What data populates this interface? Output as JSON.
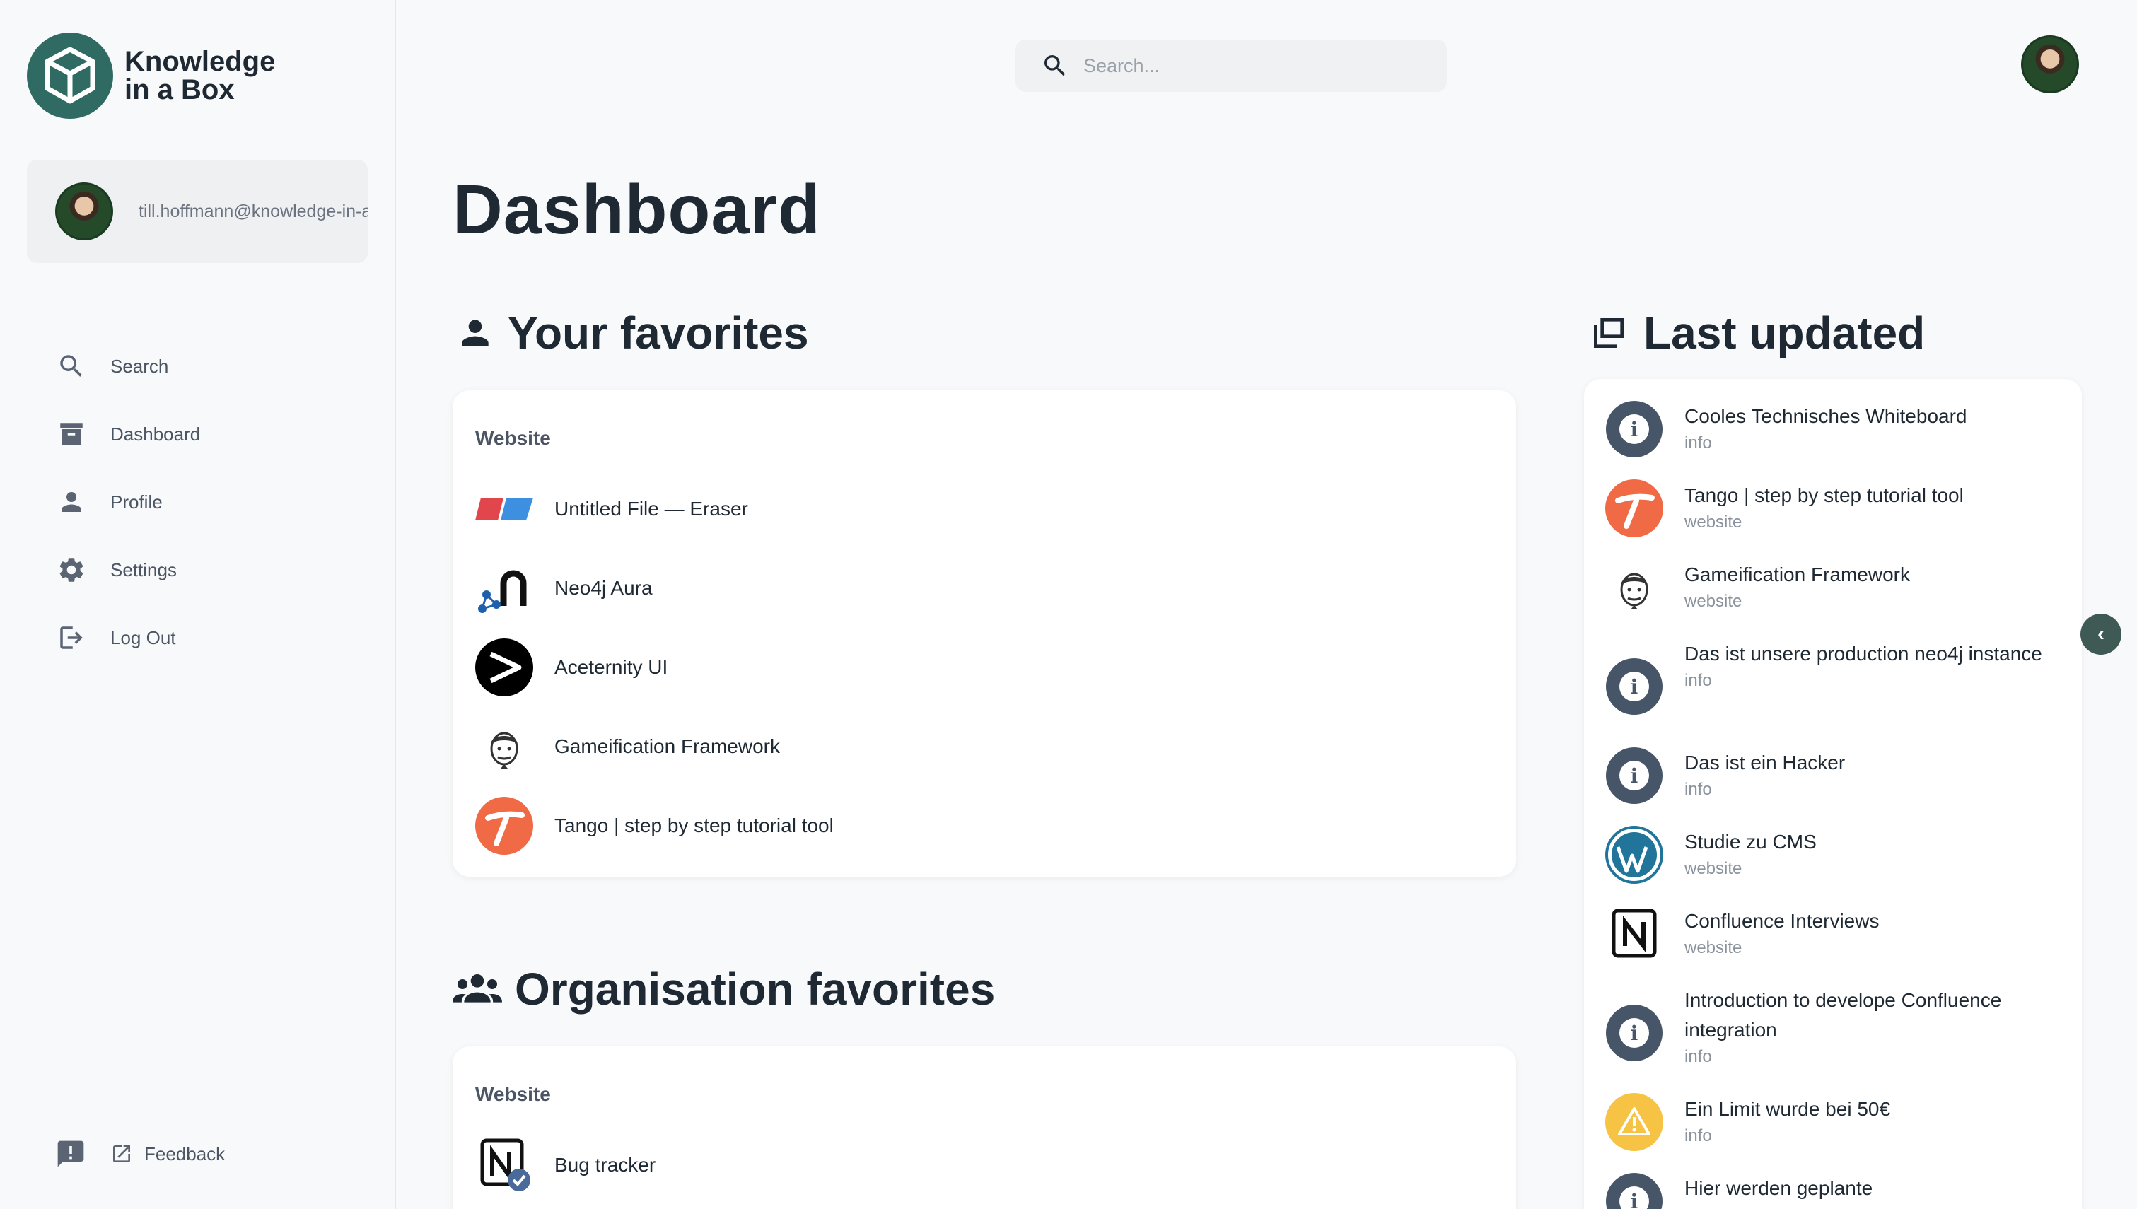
{
  "app": {
    "logo_line1": "Knowledge",
    "logo_line2": "in a Box",
    "brand_color": "#2f6b63"
  },
  "user": {
    "email": "till.hoffmann@knowledge-in-a"
  },
  "sidebar": {
    "items": [
      {
        "label": "Search",
        "icon": "search-icon"
      },
      {
        "label": "Dashboard",
        "icon": "archive-icon"
      },
      {
        "label": "Profile",
        "icon": "person-icon"
      },
      {
        "label": "Settings",
        "icon": "gear-icon"
      },
      {
        "label": "Log Out",
        "icon": "logout-icon"
      }
    ],
    "feedback_label": "Feedback"
  },
  "header": {
    "search_placeholder": "Search..."
  },
  "main": {
    "page_title": "Dashboard",
    "your_favorites": {
      "title": "Your favorites",
      "group": "Website",
      "items": [
        {
          "label": "Untitled File — Eraser",
          "icon": "eraser-icon"
        },
        {
          "label": "Neo4j Aura",
          "icon": "neo4j-icon"
        },
        {
          "label": "Aceternity UI",
          "icon": "aceternity-icon"
        },
        {
          "label": "Gameification Framework",
          "icon": "face-icon"
        },
        {
          "label": "Tango | step by step tutorial tool",
          "icon": "tango-icon"
        }
      ]
    },
    "org_favorites": {
      "title": "Organisation favorites",
      "group": "Website",
      "items": [
        {
          "label": "Bug tracker",
          "icon": "notion-verified-icon"
        }
      ]
    },
    "last_updated": {
      "title": "Last updated",
      "items": [
        {
          "title": "Cooles Technisches Whiteboard",
          "type": "info",
          "icon": "info-icon"
        },
        {
          "title": "Tango | step by step tutorial tool",
          "type": "website",
          "icon": "tango-icon"
        },
        {
          "title": "Gameification Framework",
          "type": "website",
          "icon": "face-icon"
        },
        {
          "title": "Das ist unsere production neo4j instance",
          "type": "info",
          "icon": "info-icon"
        },
        {
          "title": "Das ist ein Hacker",
          "type": "info",
          "icon": "info-icon"
        },
        {
          "title": "Studie zu CMS",
          "type": "website",
          "icon": "wordpress-icon"
        },
        {
          "title": "Confluence Interviews",
          "type": "website",
          "icon": "notion-icon"
        },
        {
          "title": "Introduction to develope Confluence integration",
          "type": "info",
          "icon": "info-icon"
        },
        {
          "title": "Ein Limit wurde bei 50€",
          "type": "info",
          "icon": "warning-icon"
        },
        {
          "title": "Hier werden geplante",
          "type": "",
          "icon": "info-icon"
        }
      ]
    }
  }
}
